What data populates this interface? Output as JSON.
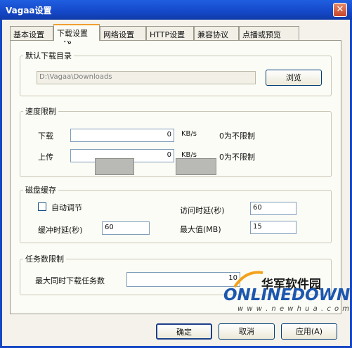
{
  "window": {
    "title": "Vagaa设置",
    "close_glyph": "✕"
  },
  "tabs": [
    {
      "label": "基本设置"
    },
    {
      "label": "下载设置",
      "active": true
    },
    {
      "label": "网络设置"
    },
    {
      "label": "HTTP设置"
    },
    {
      "label": "兼容协议"
    },
    {
      "label": "点播或预览"
    }
  ],
  "download_dir": {
    "legend": "默认下载目录",
    "path": "D:\\Vagaa\\Downloads",
    "browse_label": "浏览"
  },
  "speed_limit": {
    "legend": "速度限制",
    "download_label": "下载",
    "download_value": "0",
    "download_unit": "KB/s",
    "download_hint": "0为不限制",
    "upload_label": "上传",
    "upload_value": "0",
    "upload_unit": "KB/s",
    "upload_hint": "0为不限制"
  },
  "disk_cache": {
    "legend": "磁盘缓存",
    "auto_adjust_label": "自动调节",
    "auto_adjust_checked": false,
    "access_delay_label": "访问时延(秒)",
    "access_delay_value": "60",
    "buffer_delay_label": "缓冲时延(秒)",
    "buffer_delay_value": "60",
    "max_label": "最大值(MB)",
    "max_value": "15"
  },
  "task_limit": {
    "legend": "任务数限制",
    "max_tasks_label": "最大同时下载任务数",
    "max_tasks_value": "10"
  },
  "footer": {
    "ok_label": "确定",
    "cancel_label": "取消",
    "apply_label": "应用(A)"
  },
  "watermark": {
    "cn": "华军软件园",
    "logo": "ONLINEDOWN",
    "url": "w w w . n e w h u a . c o m"
  }
}
